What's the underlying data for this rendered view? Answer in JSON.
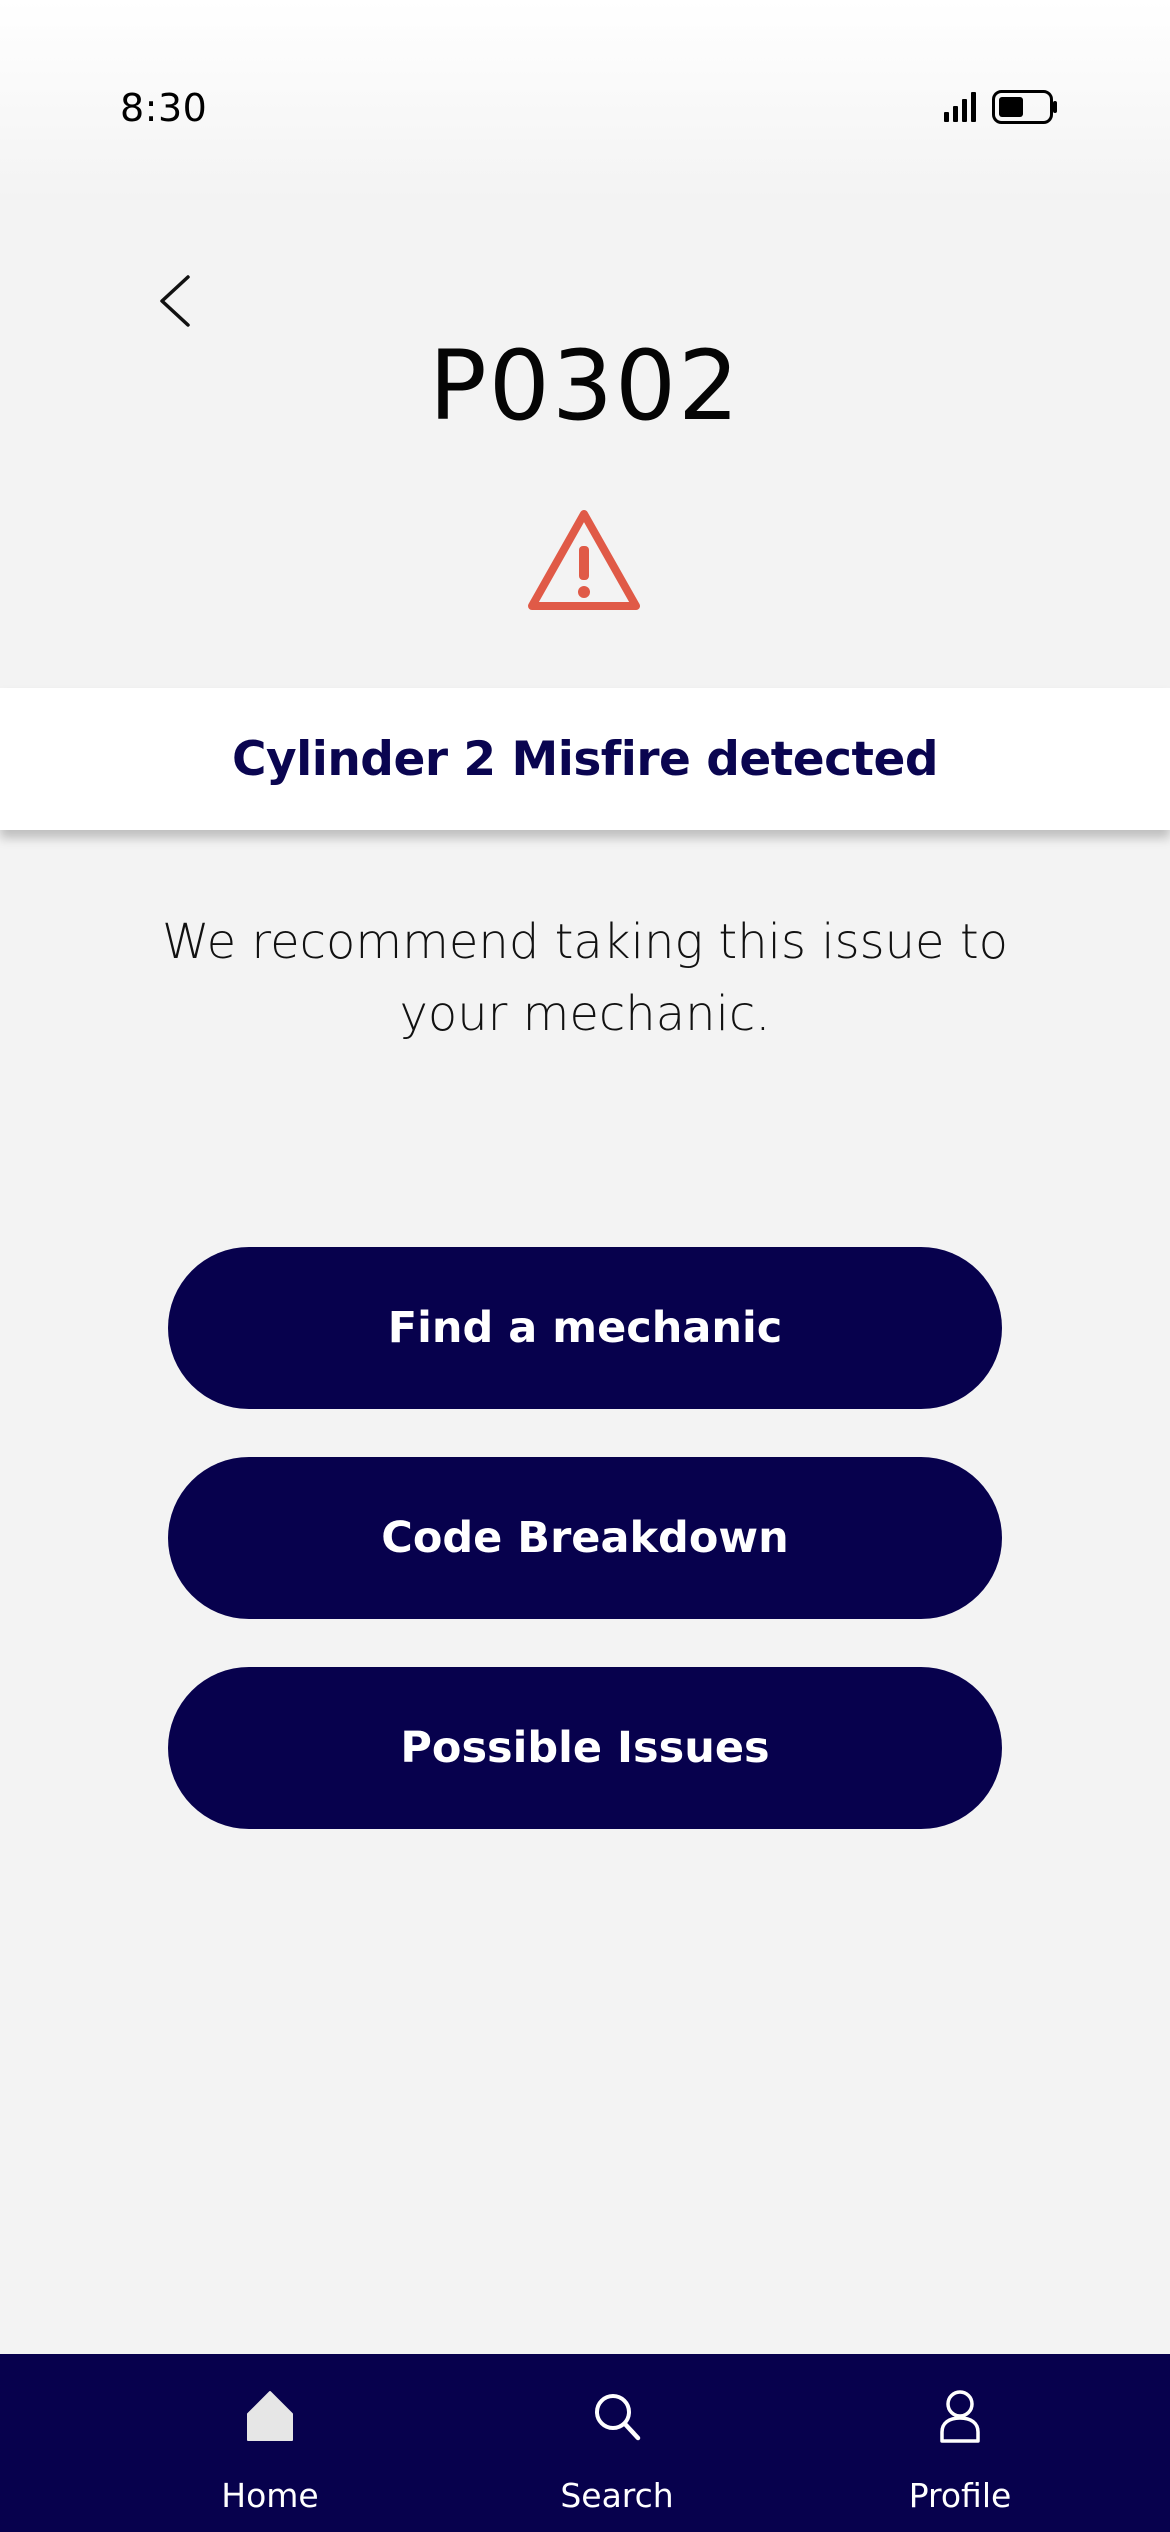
{
  "status_bar": {
    "time": "8:30",
    "signal_icon": "cellular-signal-icon",
    "battery_icon": "battery-icon"
  },
  "header": {
    "back_icon": "chevron-left-icon",
    "code": "P0302",
    "warning_icon": "warning-triangle-icon",
    "warning_color": "#e05a47"
  },
  "alert": {
    "message": "Cylinder 2 Misfire detected"
  },
  "recommendation": {
    "text": "We recommend taking this issue to your mechanic."
  },
  "actions": {
    "find_mechanic": "Find a mechanic",
    "code_breakdown": "Code Breakdown",
    "possible_issues": "Possible Issues"
  },
  "bottom_nav": {
    "items": [
      {
        "label": "Home",
        "icon": "home-icon"
      },
      {
        "label": "Search",
        "icon": "search-icon"
      },
      {
        "label": "Profile",
        "icon": "profile-icon"
      }
    ]
  },
  "colors": {
    "primary": "#07014d",
    "background": "#f3f3f3",
    "alert_text": "#0a0550",
    "warning": "#e05a47"
  }
}
